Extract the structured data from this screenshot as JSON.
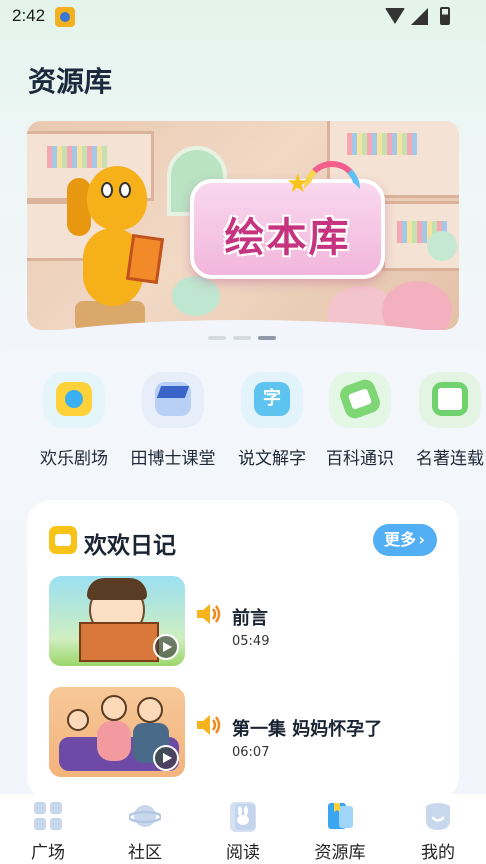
{
  "status_bar": {
    "time": "2:42"
  },
  "page": {
    "title": "资源库"
  },
  "banner": {
    "logo_text": "绘本库",
    "pager_count": 3,
    "active_index": 2
  },
  "categories": [
    {
      "label": "欢乐剧场",
      "icon": "tv-play-icon",
      "color": "#ffd23a"
    },
    {
      "label": "田博士课堂",
      "icon": "graduation-cap-icon",
      "color": "#7aa7f0"
    },
    {
      "label": "说文解字",
      "icon": "character-card-icon",
      "color": "#5cc4ef"
    },
    {
      "label": "百科通识",
      "icon": "encyclopedia-card-icon",
      "color": "#7ed674"
    },
    {
      "label": "名著连载",
      "icon": "book-icon",
      "color": "#6fd26e"
    }
  ],
  "diary": {
    "title": "欢欢日记",
    "more_label": "更多",
    "episodes": [
      {
        "title": "前言",
        "duration": "05:49"
      },
      {
        "title": "第一集 妈妈怀孕了",
        "duration": "06:07"
      }
    ]
  },
  "bottom_nav": [
    {
      "label": "广场",
      "icon": "grid-icon"
    },
    {
      "label": "社区",
      "icon": "planet-icon"
    },
    {
      "label": "阅读",
      "icon": "rabbit-book-icon"
    },
    {
      "label": "资源库",
      "icon": "library-icon",
      "active": true
    },
    {
      "label": "我的",
      "icon": "smile-face-icon"
    }
  ]
}
